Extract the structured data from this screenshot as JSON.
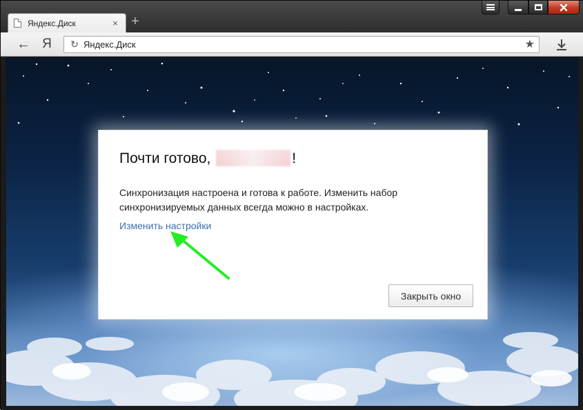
{
  "browser": {
    "tab": {
      "title": "Яндекс.Диск",
      "close_glyph": "×"
    },
    "new_tab_glyph": "+",
    "address_bar": {
      "text": "Яндекс.Диск"
    },
    "logo_letter": "Я",
    "back_glyph": "←",
    "reload_glyph": "↻",
    "star_glyph": "★",
    "icons": {
      "tab_page": "page-icon",
      "back": "arrow-left-icon",
      "reload": "reload-icon",
      "bookmark": "star-icon",
      "download": "download-icon",
      "menu": "hamburger-icon",
      "minimize": "minimize-icon",
      "maximize": "maximize-icon",
      "close": "close-icon"
    }
  },
  "dialog": {
    "title_prefix": "Почти готово,",
    "title_suffix": "!",
    "body_text": "Синхронизация настроена и готова к работе. Изменить набор синхронизируемых данных всегда можно в настройках.",
    "link_label": "Изменить настройки",
    "close_button_label": "Закрыть окно"
  },
  "colors": {
    "link": "#3b6fb0",
    "annotation_arrow": "#22ee22",
    "window_close": "#c23b22"
  }
}
